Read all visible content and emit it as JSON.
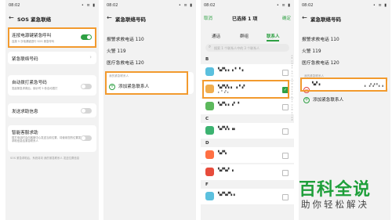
{
  "panel1": {
    "status_time": "08:02",
    "status_icons": "• ≡ ▮",
    "title": "SOS 紧急联络",
    "shake_alarm": {
      "title": "连按电源键紧急呼叫",
      "subtitle": "连按 5 次电源键进行 SOS 紧急呼叫",
      "on": true
    },
    "emergency_contacts_label": "紧急联络号码",
    "auto_dial": {
      "title": "自动拨打紧急号码",
      "subtitle": "发起紧急求救后，倒计时 5 秒自动拨打",
      "on": false
    },
    "send_help": {
      "title": "发送求助信息",
      "on": false
    },
    "smart_alarm": {
      "title": "智能客服求助",
      "subtitle": "拨打电话时会向客服中心发送当前位置，将使用您的位置发送求助信息给紧急联系人",
      "on": false
    },
    "footer_note": "SOS 紧急求助后，系统将向 我的紧急联系人 发送位置信息"
  },
  "panel2": {
    "status_time": "08:02",
    "title": "紧急联络号码",
    "numbers": [
      "报警求救电话 110",
      "火警 119",
      "医疗急救电话 120"
    ],
    "section_label": "我的紧急联系人",
    "add_contact": "添加紧急联系人"
  },
  "panel3": {
    "status_time": "08:02",
    "cancel": "取消",
    "title": "已选择 1 项",
    "confirm": "确定",
    "tabs": [
      "通话",
      "群组",
      "联系人"
    ],
    "search_placeholder": "搜索 1 个联系人中的 3 个联系人",
    "groups": [
      {
        "letter": "B",
        "contacts": [
          {
            "name": "▚▞▚ ▖▗ ▘▝▗",
            "number": "",
            "color": "#5bc0de",
            "checked": false
          },
          {
            "name": "▚▞▚▚ ▖ ▗▝▗▘",
            "number": "▖▝ ▗▘▖",
            "color": "#f0ad4e",
            "checked": true
          },
          {
            "name": "▚▞▚ ▖▗▘▝",
            "number": "",
            "color": "#5cb85c",
            "checked": false
          }
        ]
      },
      {
        "letter": "C",
        "contacts": [
          {
            "name": "▚▞▚▚ ▗▖",
            "number": "",
            "color": "#3cb371",
            "checked": false
          }
        ]
      },
      {
        "letter": "D",
        "contacts": [
          {
            "name": "▚▞▚",
            "number": "",
            "color": "#ff7043",
            "checked": false
          },
          {
            "name": "▚▞▚▞ ▗",
            "number": "",
            "color": "#e74c3c",
            "checked": false
          }
        ]
      },
      {
        "letter": "F",
        "contacts": [
          {
            "name": "▚▞▚▞▚ ▖",
            "number": "",
            "color": "#5bc0de",
            "checked": false
          }
        ]
      }
    ],
    "alphabet": "A B C D E F G H I J K L M N O P Q R S T U V W X Y Z #"
  },
  "panel4": {
    "status_time": "08:02",
    "title": "紧急联络号码",
    "numbers": [
      "报警求救电话 110",
      "火警 119",
      "医疗急救电话 120"
    ],
    "section_label": "我的紧急联系人",
    "contact_name": "▚▞▗",
    "contact_number": "▖ ▗▘▞▝ ▖▗",
    "add_contact": "添加紧急联系人"
  },
  "watermark": {
    "line1": "百科全说",
    "line2": "助你轻松解决",
    "color": "#1e9f3a"
  }
}
